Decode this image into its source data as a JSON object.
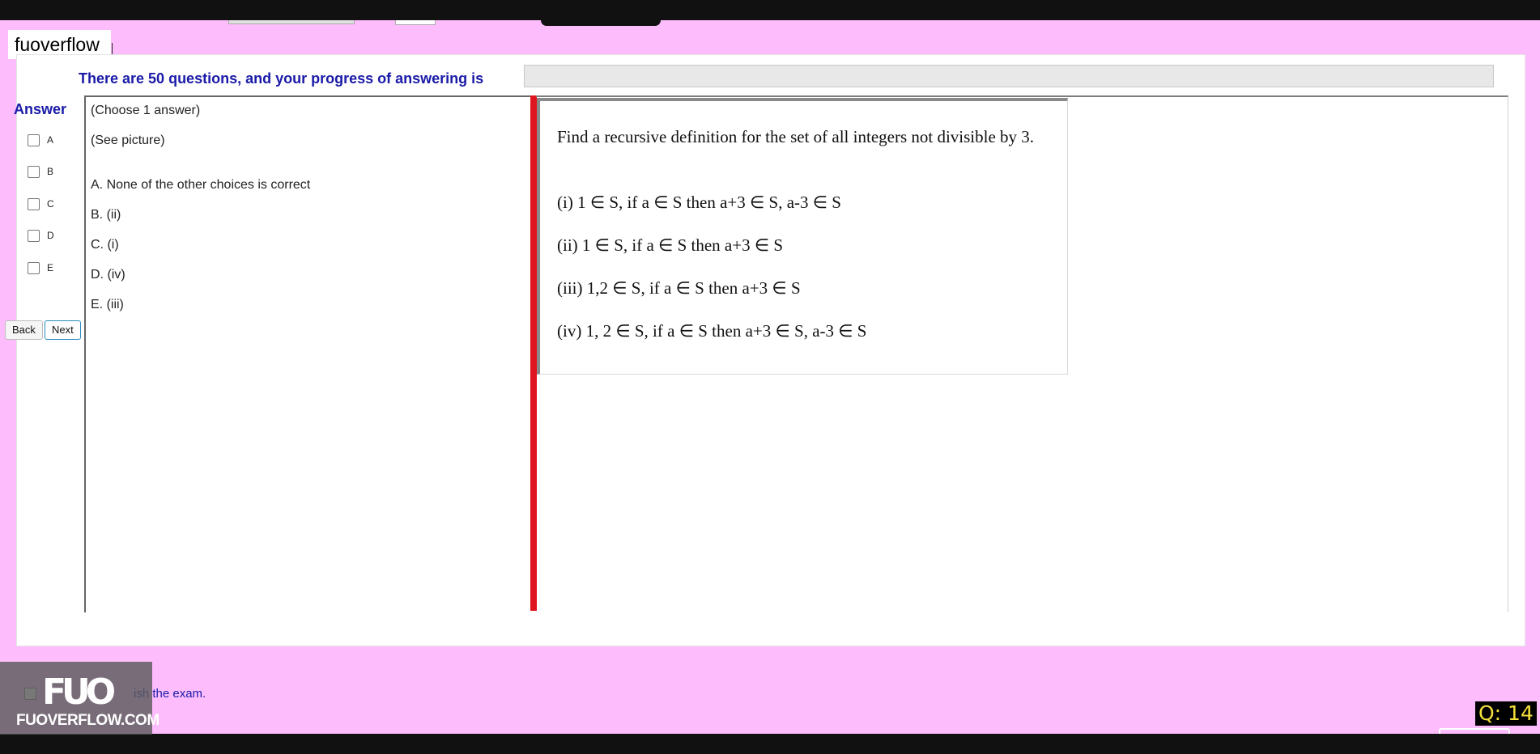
{
  "app": {
    "logo_text": "fuoverflow"
  },
  "progress": {
    "label": "There are 50 questions, and your progress of answering is",
    "value_fraction": 0
  },
  "answer_panel": {
    "heading": "Answer",
    "options": [
      "A",
      "B",
      "C",
      "D",
      "E"
    ],
    "back_label": "Back",
    "next_label": "Next"
  },
  "choices": {
    "instruction": "(Choose 1 answer)",
    "see_picture": "(See picture)",
    "items": [
      "A.  None of the other choices is correct",
      "B.  (ii)",
      "C.  (i)",
      "D.  (iv)",
      "E.  (iii)"
    ]
  },
  "question": {
    "prompt": "Find a recursive definition for the set of all integers not divisible by 3.",
    "options": [
      "(i)   1 ∈ S, if a  ∈ S then a+3  ∈  S, a-3  ∈  S",
      "(ii)  1 ∈ S, if a  ∈ S then a+3  ∈  S",
      "(iii) 1,2  ∈ S, if a  ∈ S then a+3  ∈  S",
      "(iv) 1, 2 ∈ S, if a  ∈ S then a+3  ∈  S, a-3  ∈  S"
    ]
  },
  "finish": {
    "label": "ish the exam."
  },
  "watermark": {
    "mark": "FUO",
    "site": "FUOVERFLOW.COM"
  },
  "counter": {
    "text": "Q: 14"
  },
  "colors": {
    "page_background": "#fdbdfc",
    "accent_blue": "#1a1aa8",
    "divider_red": "#e0161e",
    "counter_yellow": "#f4e03a"
  }
}
